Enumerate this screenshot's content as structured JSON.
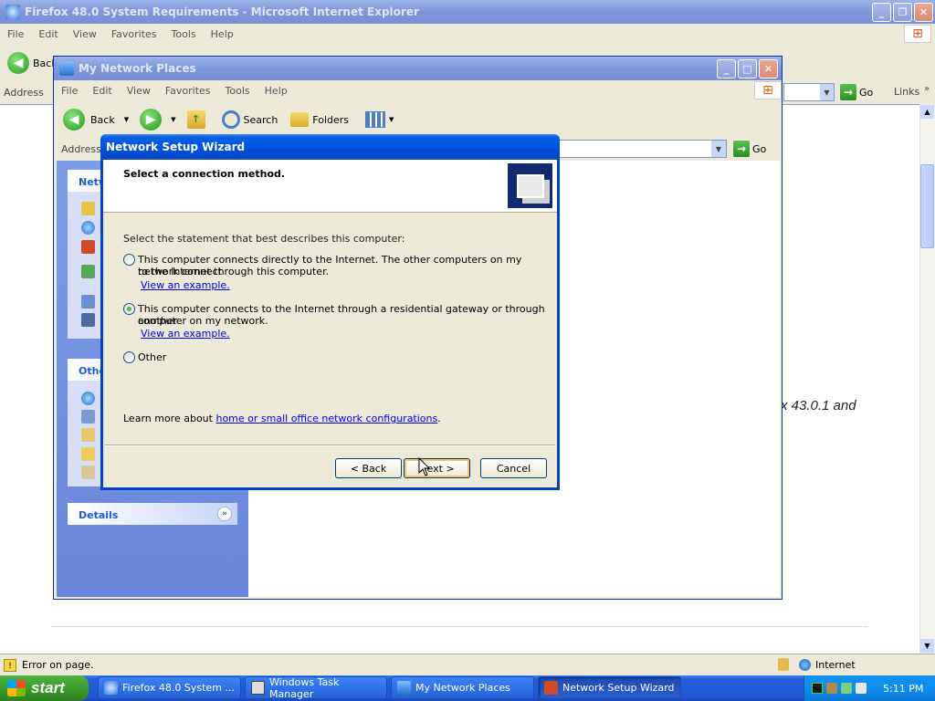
{
  "ie": {
    "title": "Firefox 48.0 System Requirements - Microsoft Internet Explorer",
    "menu": [
      "File",
      "Edit",
      "View",
      "Favorites",
      "Tools",
      "Help"
    ],
    "back_label": "Back",
    "address_label": "Address",
    "go_label": "Go",
    "links_label": "Links",
    "body_fragment": "x 43.0.1 and",
    "status_text": "Error on page.",
    "zone_text": "Internet"
  },
  "explorer": {
    "title": "My Network Places",
    "menu": [
      "File",
      "Edit",
      "View",
      "Favorites",
      "Tools",
      "Help"
    ],
    "back_label": "Back",
    "search_label": "Search",
    "folders_label": "Folders",
    "address_label": "Address",
    "go_label": "Go",
    "panel_network_title": "Netw",
    "panel_other_title": "Othe",
    "panel_details_title": "Details"
  },
  "wizard": {
    "title": "Network Setup Wizard",
    "heading": "Select a connection method.",
    "prompt": "Select the statement that best describes this computer:",
    "options": [
      {
        "text_line1": "This computer connects directly to the Internet. The other computers on my network connect",
        "text_line2": "to the Internet through this computer.",
        "link": "View an example.",
        "checked": false
      },
      {
        "text_line1": "This computer connects to the Internet through a residential gateway or through another",
        "text_line2": "computer on my network.",
        "link": "View an example.",
        "checked": true
      },
      {
        "text_line1": "Other",
        "checked": false
      }
    ],
    "learn_prefix": "Learn more about ",
    "learn_link": "home or small office network configurations",
    "learn_suffix": ".",
    "back_button": "< Back",
    "next_button": "Next >",
    "cancel_button": "Cancel"
  },
  "taskbar": {
    "start_label": "start",
    "tasks": [
      "Firefox 48.0 System ...",
      "Windows Task Manager",
      "My Network Places",
      "Network Setup Wizard"
    ],
    "clock": "5:11 PM"
  },
  "colors": {
    "xp_blue": "#0054e3",
    "taskbar_blue": "#245edb",
    "start_green": "#3c9a2c",
    "window_face": "#ece9d8",
    "tray_blue": "#0f8ef0"
  }
}
